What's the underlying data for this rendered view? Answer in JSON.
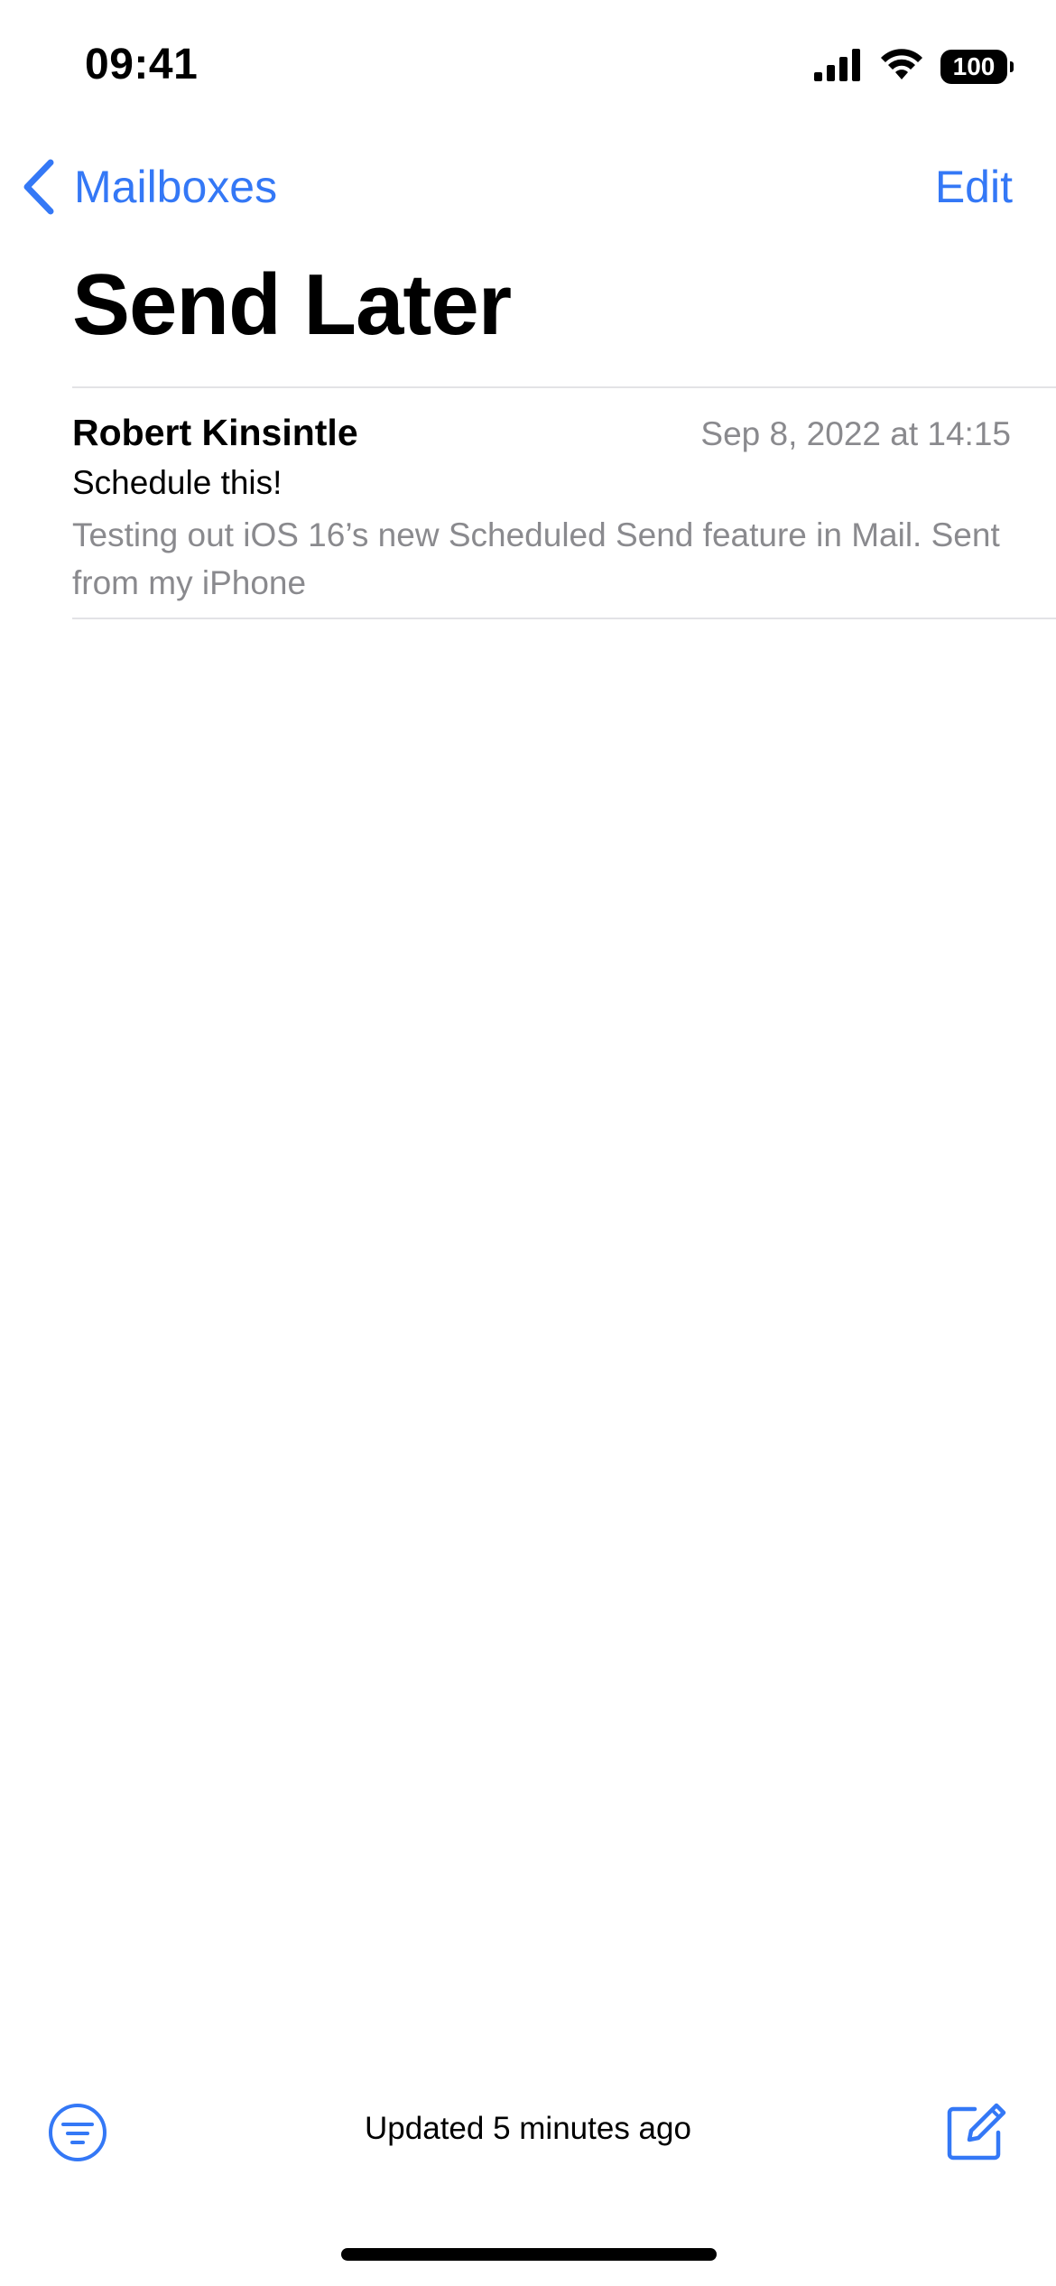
{
  "status_bar": {
    "time": "09:41",
    "battery_level": "100"
  },
  "nav": {
    "back_label": "Mailboxes",
    "edit_label": "Edit"
  },
  "page": {
    "title": "Send Later"
  },
  "messages": [
    {
      "sender": "Robert Kinsintle",
      "date": "Sep 8, 2022 at 14:15",
      "subject": "Schedule this!",
      "preview": "Testing out iOS 16’s new Scheduled Send feature in Mail. Sent from my iPhone"
    }
  ],
  "toolbar": {
    "status_text": "Updated 5 minutes ago"
  },
  "icons": {
    "back": "chevron-left-icon",
    "signal": "cellular-signal-icon",
    "wifi": "wifi-icon",
    "battery": "battery-icon",
    "filter": "filter-icon",
    "compose": "compose-icon"
  },
  "colors": {
    "accent": "#3478f6",
    "secondary_text": "#8a8a8e",
    "separator": "#e3e3e6"
  }
}
